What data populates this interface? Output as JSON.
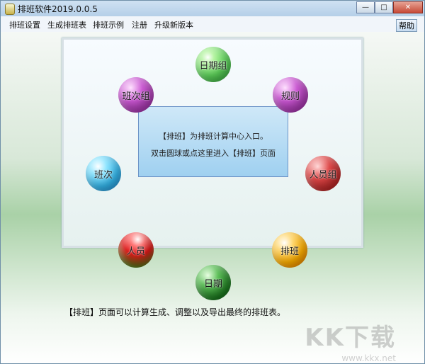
{
  "title": "排班软件2019.0.0.5",
  "menu": [
    "排班设置",
    "生成排班表",
    "排班示例",
    "注册",
    "升级新版本"
  ],
  "help_label": "帮助",
  "info_box": {
    "line1": "【排班】为排班计算中心入口。",
    "line2": "双击圆球或点这里进入【排班】页面"
  },
  "balls": {
    "date_group": "日期组",
    "shift_group": "班次组",
    "rule": "规则",
    "shift": "班次",
    "person_group": "人员组",
    "person": "人员",
    "schedule": "排班",
    "date": "日期"
  },
  "bottom_text": "【排班】页面可以计算生成、调整以及导出最终的排班表。",
  "watermark": "KK下载",
  "watermark_url": "www.kkx.net",
  "window_buttons": [
    "minimize",
    "maximize",
    "close"
  ]
}
